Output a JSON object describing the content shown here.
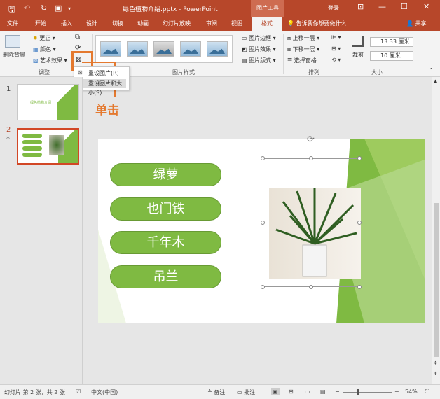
{
  "titlebar": {
    "doc_title": "绿色植物介绍.pptx - PowerPoint",
    "context_tab": "图片工具",
    "login": "登录"
  },
  "tabs": [
    "文件",
    "开始",
    "插入",
    "设计",
    "切换",
    "动画",
    "幻灯片放映",
    "审阅",
    "视图",
    "格式"
  ],
  "tell_me": "告诉我你想要做什么",
  "share": "共享",
  "ribbon": {
    "remove_bg": "删除背景",
    "corrections": "更正",
    "color": "颜色",
    "artistic": "艺术效果",
    "adjust_label": "调整",
    "styles_label": "图片样式",
    "border": "图片边框",
    "effects": "图片效果",
    "layout": "图片版式",
    "bring_forward": "上移一层",
    "send_backward": "下移一层",
    "selection_pane": "选择窗格",
    "arrange_label": "排列",
    "crop": "裁剪",
    "height": "13.33 厘米",
    "width": "10 厘米",
    "size_label": "大小"
  },
  "reset_menu": {
    "item1": "重设图片(R)",
    "item2": "重设图片和大小(S)"
  },
  "callout": "单击",
  "thumbnails": [
    {
      "num": "1",
      "text": "绿色植物介绍"
    },
    {
      "num": "2",
      "marker": "*"
    }
  ],
  "slide": {
    "items": [
      "绿萝",
      "也门铁",
      "千年木",
      "吊兰"
    ]
  },
  "status": {
    "slide_info": "幻灯片 第 2 张，共 2 张",
    "language": "中文(中国)",
    "notes": "备注",
    "comments": "批注",
    "zoom": "54%"
  },
  "colors": {
    "brand": "#b7472a",
    "accent": "#e4792f",
    "green": "#7fba42"
  }
}
